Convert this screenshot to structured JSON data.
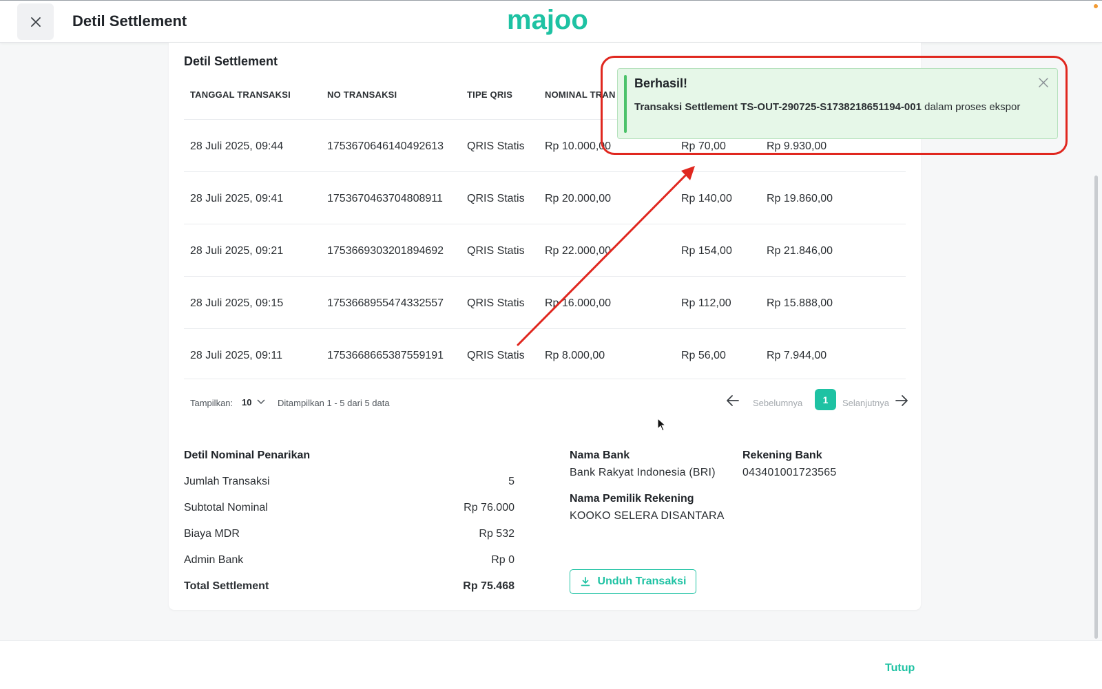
{
  "header": {
    "title": "Detil Settlement",
    "brand": "majoo",
    "brand_color": "#1ec2a3"
  },
  "card": {
    "title": "Detil Settlement"
  },
  "table": {
    "columns": [
      "TANGGAL TRANSAKSI",
      "NO TRANSAKSI",
      "TIPE QRIS",
      "NOMINAL TRAN"
    ],
    "rows": [
      {
        "date": "28 Juli 2025, 09:44",
        "no": "1753670646140492613",
        "type": "QRIS Statis",
        "nominal": "Rp 10.000,00",
        "mdr": "Rp 70,00",
        "net": "Rp 9.930,00"
      },
      {
        "date": "28 Juli 2025, 09:41",
        "no": "1753670463704808911",
        "type": "QRIS Statis",
        "nominal": "Rp 20.000,00",
        "mdr": "Rp 140,00",
        "net": "Rp 19.860,00"
      },
      {
        "date": "28 Juli 2025, 09:21",
        "no": "1753669303201894692",
        "type": "QRIS Statis",
        "nominal": "Rp 22.000,00",
        "mdr": "Rp 154,00",
        "net": "Rp 21.846,00"
      },
      {
        "date": "28 Juli 2025, 09:15",
        "no": "1753668955474332557",
        "type": "QRIS Statis",
        "nominal": "Rp 16.000,00",
        "mdr": "Rp 112,00",
        "net": "Rp 15.888,00"
      },
      {
        "date": "28 Juli 2025, 09:11",
        "no": "1753668665387559191",
        "type": "QRIS Statis",
        "nominal": "Rp 8.000,00",
        "mdr": "Rp 56,00",
        "net": "Rp 7.944,00"
      }
    ]
  },
  "pagination": {
    "show_label": "Tampilkan:",
    "page_size": "10",
    "info": "Ditampilkan 1 - 5 dari 5 data",
    "prev_label": "Sebelumnya",
    "current_page": "1",
    "next_label": "Selanjutnya"
  },
  "summary": {
    "title": "Detil Nominal Penarikan",
    "items": [
      {
        "label": "Jumlah Transaksi",
        "value": "5"
      },
      {
        "label": "Subtotal Nominal",
        "value": "Rp 76.000"
      },
      {
        "label": "Biaya MDR",
        "value": "Rp 532"
      },
      {
        "label": "Admin Bank",
        "value": "Rp 0"
      }
    ],
    "total_label": "Total Settlement",
    "total_value": "Rp 75.468"
  },
  "bank": {
    "bank_name_label": "Nama Bank",
    "bank_name": "Bank Rakyat Indonesia (BRI)",
    "account_label": "Rekening Bank",
    "account_number": "043401001723565",
    "owner_label": "Nama Pemilik Rekening",
    "owner_name": "KOOKO SELERA DISANTARA"
  },
  "download_button": "Unduh Transaksi",
  "footer": {
    "close_label": "Tutup"
  },
  "toast": {
    "title": "Berhasil!",
    "message_bold": "Transaksi Settlement TS-OUT-290725-S1738218651194-001",
    "message_rest": " dalam proses ekspor"
  }
}
